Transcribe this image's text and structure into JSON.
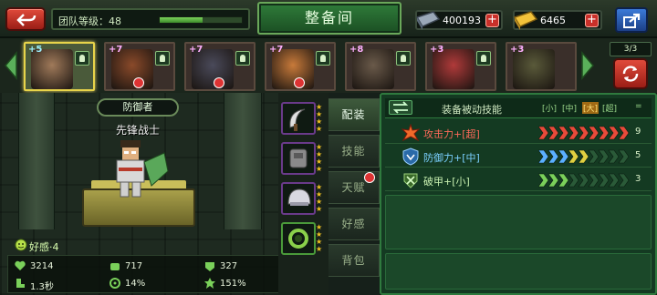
{
  "top": {
    "team_level_label": "团队等级：48",
    "team_level_progress": 0.52,
    "title": "整备间",
    "gems": "400193",
    "gold": "6465"
  },
  "strip": {
    "heroes": [
      {
        "level": "+5",
        "level_color": "#9cf0ff",
        "active": true,
        "tag": true,
        "badge": false,
        "skin": "#a07a5a"
      },
      {
        "level": "+7",
        "level_color": "#ffb0ff",
        "active": false,
        "tag": true,
        "badge": true,
        "skin": "#8a4a2a"
      },
      {
        "level": "+7",
        "level_color": "#ffb0ff",
        "active": false,
        "tag": true,
        "badge": true,
        "skin": "#4a4a5a"
      },
      {
        "level": "+7",
        "level_color": "#ffb0ff",
        "active": false,
        "tag": true,
        "badge": true,
        "skin": "#c87a3a"
      },
      {
        "level": "+8",
        "level_color": "#ffb0ff",
        "active": false,
        "tag": true,
        "badge": false,
        "skin": "#6a5a4a"
      },
      {
        "level": "+3",
        "level_color": "#ffb0ff",
        "active": false,
        "tag": true,
        "badge": false,
        "skin": "#b03a3a"
      },
      {
        "level": "+3",
        "level_color": "#ffb0ff",
        "active": false,
        "tag": false,
        "badge": false,
        "skin": "#5a5a3a"
      }
    ],
    "team_count": "3/3"
  },
  "hero": {
    "role": "防御者",
    "name": "先锋战士",
    "affinity": "好感·4",
    "stats": {
      "hp": "3214",
      "atk": "717",
      "def": "327",
      "speed": "1.3秒",
      "crit": "14%",
      "crit_dmg": "151%"
    }
  },
  "tabs": [
    "配装",
    "技能",
    "天赋",
    "好感",
    "背包"
  ],
  "panel": {
    "title": "装备被动技能",
    "columns": [
      "小",
      "中",
      "大",
      "超"
    ],
    "eq": "=",
    "skills": [
      {
        "name": "攻击力+[超]",
        "name_color": "#ff6a5a",
        "count": "9",
        "chev_colors": [
          "#e84a3a",
          "#e84a3a",
          "#e84a3a",
          "#e84a3a",
          "#e84a3a",
          "#e84a3a",
          "#e84a3a",
          "#e84a3a",
          "#e84a3a"
        ]
      },
      {
        "name": "防御力+[中]",
        "name_color": "#7ad0ff",
        "count": "5",
        "chev_colors": [
          "#5ab0ff",
          "#5ab0ff",
          "#5ab0ff",
          "#e0d040",
          "#e0d040",
          "#2a5a38",
          "#2a5a38",
          "#2a5a38",
          "#2a5a38"
        ]
      },
      {
        "name": "破甲+[小]",
        "name_color": "#c8f0b0",
        "count": "3",
        "chev_colors": [
          "#7ad05a",
          "#7ad05a",
          "#7ad05a",
          "#2a5a38",
          "#2a5a38",
          "#2a5a38",
          "#2a5a38",
          "#2a5a38",
          "#2a5a38"
        ]
      }
    ]
  },
  "colors": {
    "accent_red": "#c9302a",
    "panel_green": "#143a22",
    "gold_star": "#f0c020"
  }
}
